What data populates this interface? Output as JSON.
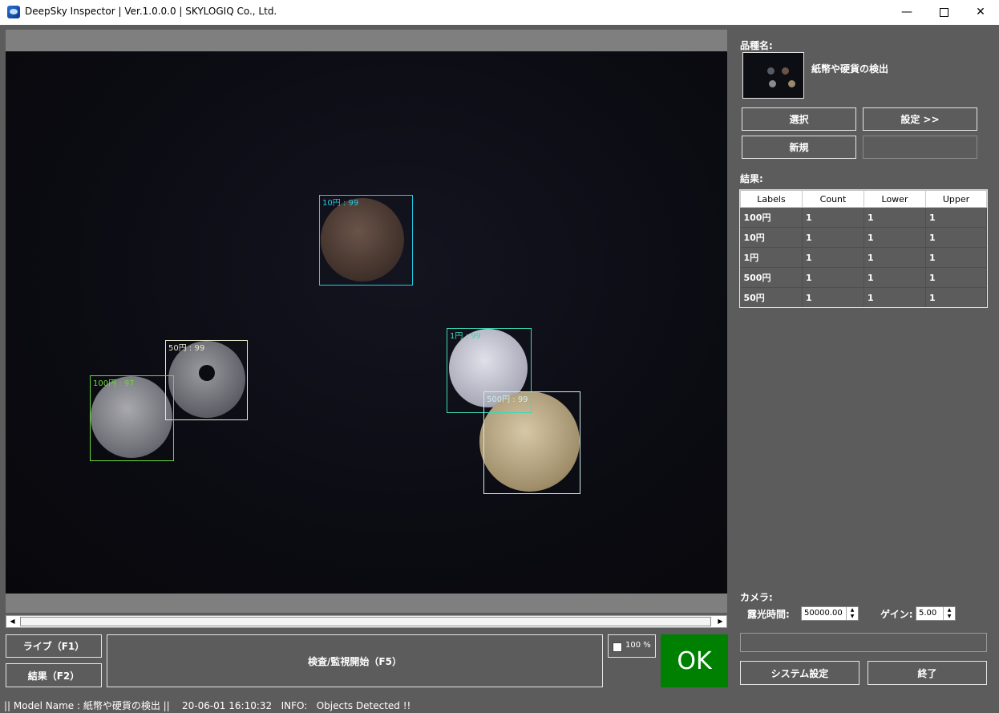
{
  "window": {
    "title": "DeepSky Inspector | Ver.1.0.0.0 | SKYLOGIQ Co., Ltd.",
    "controls": {
      "minimize": "—",
      "close": "✕"
    }
  },
  "viewer": {
    "detections": [
      {
        "label": "10円 : 99",
        "color": "#23c8e0"
      },
      {
        "label": "50円 : 99",
        "color": "#e8e8cc"
      },
      {
        "label": "100円 : 97",
        "color": "#6cd83a"
      },
      {
        "label": "1円 : 99",
        "color": "#3cd8b4"
      },
      {
        "label": "500円 : 99",
        "color": "#cfeee8"
      }
    ],
    "scroll": {
      "left": "◀",
      "right": "▶"
    }
  },
  "controls": {
    "live_button": "ライブ（F1）",
    "result_button": "結果（F2）",
    "inspect_button": "検査/監視開始（F5）",
    "zoom_label": "100 %",
    "judgement": "OK",
    "judgement_color": "#008000"
  },
  "status": {
    "text": "|| Model Name : 紙幣や硬貨の検出 ||    20-06-01 16:10:32   INFO:   Objects Detected !!"
  },
  "panel": {
    "product_label": "品種名:",
    "model_name": "紙幣や硬貨の検出",
    "select_button": "選択",
    "settings_button": "設定 >>",
    "new_button": "新規",
    "results_label": "結果:",
    "table": {
      "headers": [
        "Labels",
        "Count",
        "Lower",
        "Upper"
      ],
      "rows": [
        [
          "100円",
          "1",
          "1",
          "1"
        ],
        [
          "10円",
          "1",
          "1",
          "1"
        ],
        [
          "1円",
          "1",
          "1",
          "1"
        ],
        [
          "500円",
          "1",
          "1",
          "1"
        ],
        [
          "50円",
          "1",
          "1",
          "1"
        ]
      ]
    },
    "camera_label": "カメラ:",
    "exposure_label": "露光時間:",
    "exposure_value": "50000.00",
    "gain_label": "ゲイン:",
    "gain_value": "5.00",
    "system_settings_button": "システム設定",
    "exit_button": "終了"
  }
}
